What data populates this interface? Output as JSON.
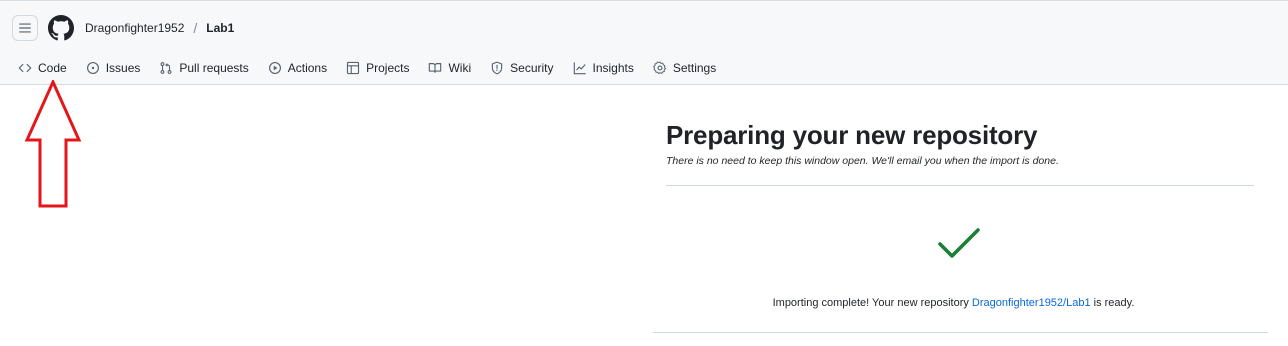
{
  "breadcrumb": {
    "owner": "Dragonfighter1952",
    "separator": "/",
    "repo": "Lab1"
  },
  "nav": {
    "tabs": [
      {
        "label": "Code",
        "icon": "code-icon"
      },
      {
        "label": "Issues",
        "icon": "issue-icon"
      },
      {
        "label": "Pull requests",
        "icon": "pull-request-icon"
      },
      {
        "label": "Actions",
        "icon": "play-icon"
      },
      {
        "label": "Projects",
        "icon": "table-icon"
      },
      {
        "label": "Wiki",
        "icon": "book-icon"
      },
      {
        "label": "Security",
        "icon": "shield-icon"
      },
      {
        "label": "Insights",
        "icon": "graph-icon"
      },
      {
        "label": "Settings",
        "icon": "gear-icon"
      }
    ]
  },
  "main": {
    "title": "Preparing your new repository",
    "subtitle": "There is no need to keep this window open. We'll email you when the import is done.",
    "status_prefix": "Importing complete! Your new repository ",
    "status_link": "Dragonfighter1952/Lab1",
    "status_suffix": " is ready."
  },
  "colors": {
    "link": "#0969da",
    "success": "#1a7f37",
    "annotation_arrow": "#e3161b"
  }
}
